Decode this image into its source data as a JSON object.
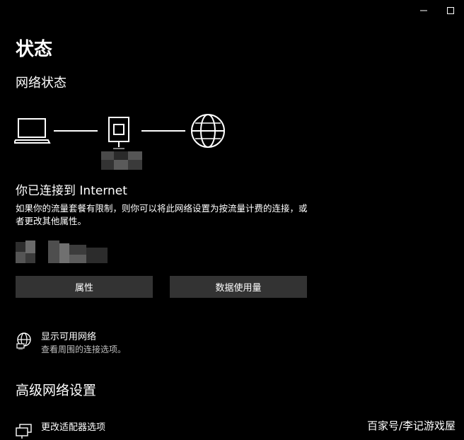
{
  "window_controls": {
    "minimize_icon": "minimize-icon",
    "maximize_icon": "maximize-icon"
  },
  "page": {
    "title": "状态"
  },
  "network_status": {
    "title": "网络状态",
    "connected_heading": "你已连接到 Internet",
    "connected_desc": "如果你的流量套餐有限制，则你可以将此网络设置为按流量计费的连接，或者更改其他属性。",
    "buttons": {
      "properties": "属性",
      "data_usage": "数据使用量"
    }
  },
  "show_available": {
    "label": "显示可用网络",
    "sub": "查看周围的连接选项。",
    "icon": "globe-network-icon"
  },
  "advanced": {
    "title": "高级网络设置",
    "change_adapter": {
      "label": "更改适配器选项",
      "icon": "adapter-icon"
    }
  },
  "watermark": "百家号/李记游戏屋",
  "colors": {
    "background": "#000000",
    "button_bg": "#333333",
    "text": "#ffffff",
    "subtext": "#bfbfbf"
  }
}
